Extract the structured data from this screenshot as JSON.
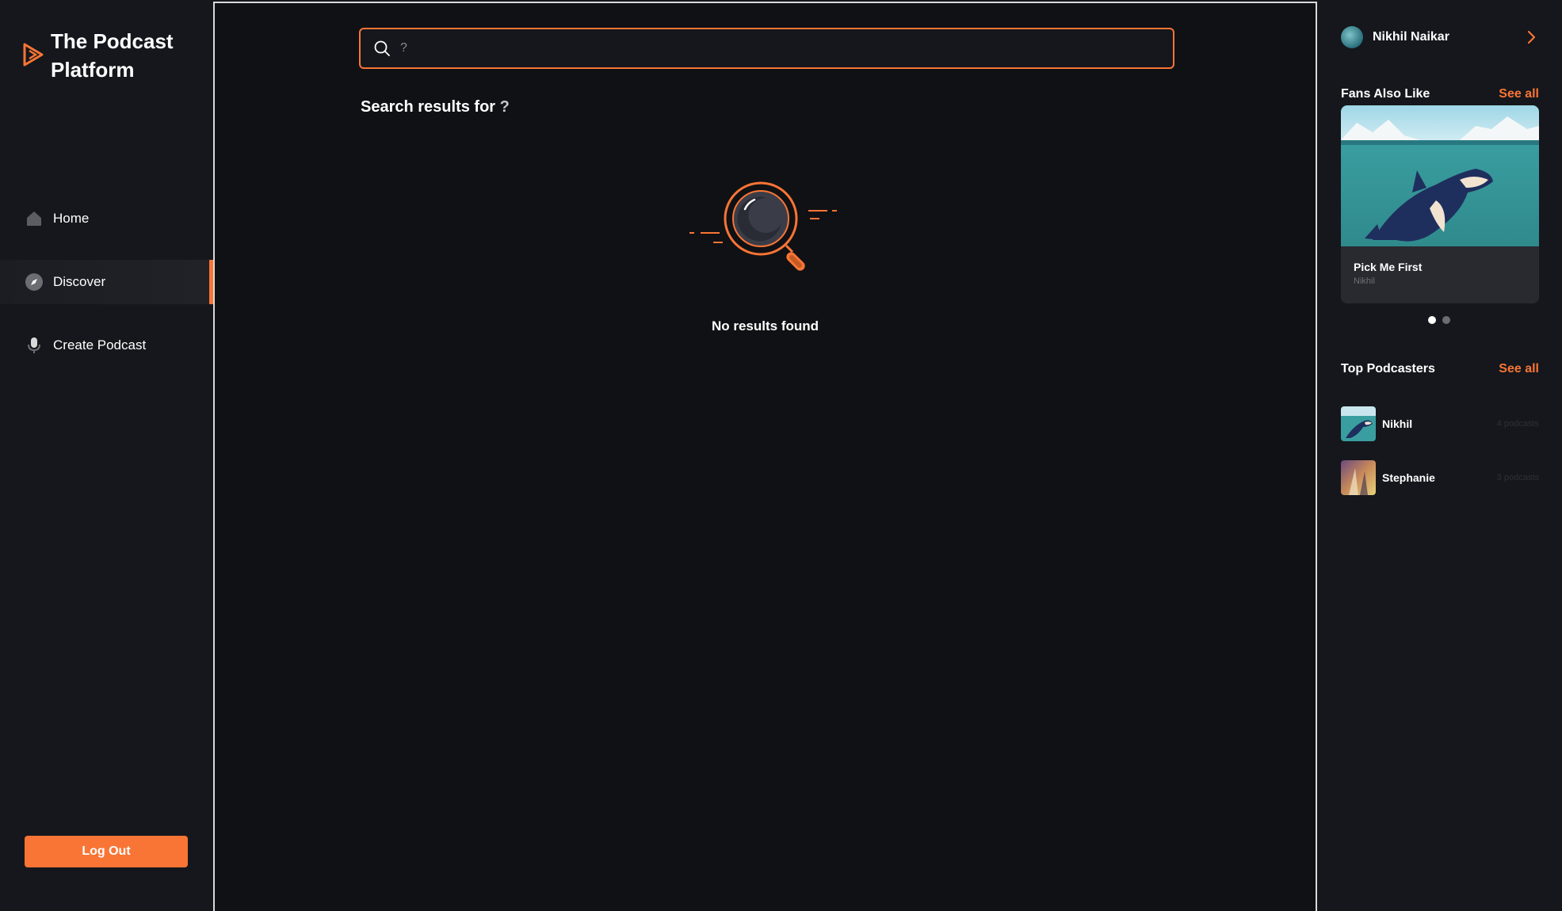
{
  "app": {
    "title": "The Podcast Platform"
  },
  "sidebar": {
    "items": [
      {
        "label": "Home",
        "icon": "home-icon",
        "active": false
      },
      {
        "label": "Discover",
        "icon": "compass-icon",
        "active": true
      },
      {
        "label": "Create Podcast",
        "icon": "microphone-icon",
        "active": false
      }
    ],
    "logout_label": "Log Out"
  },
  "search": {
    "value": "?",
    "icon": "search-icon"
  },
  "results": {
    "heading_prefix": "Search results for",
    "query": "?",
    "empty_text": "No results found",
    "empty_icon": "magnifier-illustration"
  },
  "profile": {
    "name": "Nikhil Naikar",
    "chevron_icon": "chevron-right-icon"
  },
  "fans_also_like": {
    "title": "Fans Also Like",
    "see_all": "See all",
    "card": {
      "title": "Pick Me First",
      "author": "Nikhil"
    },
    "dots": {
      "count": 2,
      "active_index": 0
    }
  },
  "top_podcasters": {
    "title": "Top Podcasters",
    "see_all": "See all",
    "items": [
      {
        "name": "Nikhil",
        "count": "4 podcasts"
      },
      {
        "name": "Stephanie",
        "count": "3 podcasts"
      }
    ]
  },
  "colors": {
    "accent": "#f97535",
    "background": "#15171c",
    "main_background": "#101114"
  }
}
